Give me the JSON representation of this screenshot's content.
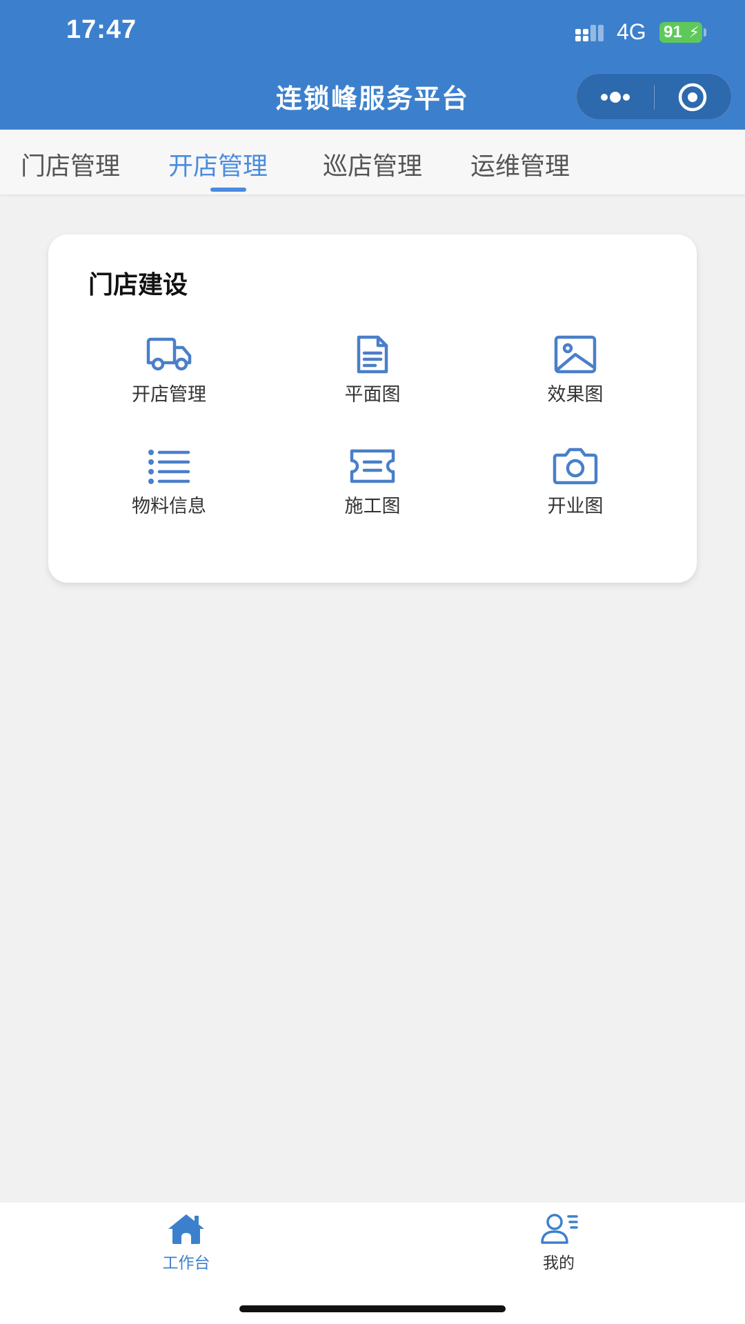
{
  "status_bar": {
    "time": "17:47",
    "network": "4G",
    "battery": "91",
    "icons": [
      "signal-icon",
      "battery-icon",
      "charging-bolt-icon"
    ]
  },
  "nav_bar": {
    "title": "连锁峰服务平台",
    "capsule_icons": [
      "more-dots-icon",
      "close-target-icon"
    ]
  },
  "tabs": [
    {
      "label": "门店管理",
      "active": false
    },
    {
      "label": "开店管理",
      "active": true
    },
    {
      "label": "巡店管理",
      "active": false
    },
    {
      "label": "运维管理",
      "active": false
    }
  ],
  "card": {
    "title": "门店建设",
    "items": [
      {
        "label": "开店管理",
        "icon": "truck-icon"
      },
      {
        "label": "平面图",
        "icon": "document-icon"
      },
      {
        "label": "效果图",
        "icon": "image-icon"
      },
      {
        "label": "物料信息",
        "icon": "list-icon"
      },
      {
        "label": "施工图",
        "icon": "ticket-icon"
      },
      {
        "label": "开业图",
        "icon": "camera-icon"
      }
    ]
  },
  "tabbar": {
    "items": [
      {
        "label": "工作台",
        "icon": "home-icon",
        "active": true
      },
      {
        "label": "我的",
        "icon": "user-profile-icon",
        "active": false
      }
    ]
  },
  "colors": {
    "header": "#3c80cd",
    "accent": "#4a8be0",
    "icon": "#4a7fc9",
    "page_bg": "#f1f1f1",
    "battery": "#5ec95a"
  }
}
